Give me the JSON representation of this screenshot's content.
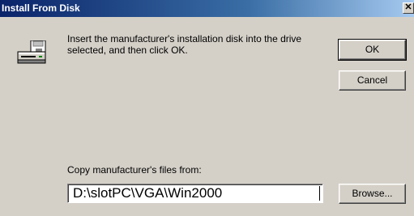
{
  "window": {
    "title": "Install From Disk",
    "close_glyph": "✕"
  },
  "dialog": {
    "icon": "floppy-disk-drive-icon",
    "message": "Insert the manufacturer's installation disk into the drive\nselected, and then click OK.",
    "ok_label": "OK",
    "cancel_label": "Cancel",
    "copy_from_label": "Copy manufacturer's files from:",
    "path_value": "D:\\slotPC\\VGA\\Win2000",
    "browse_label": "Browse..."
  },
  "colors": {
    "face": "#d4d0c8",
    "titlebar_start": "#0a246a",
    "titlebar_end": "#a6caf0",
    "title_text": "#ffffff"
  }
}
